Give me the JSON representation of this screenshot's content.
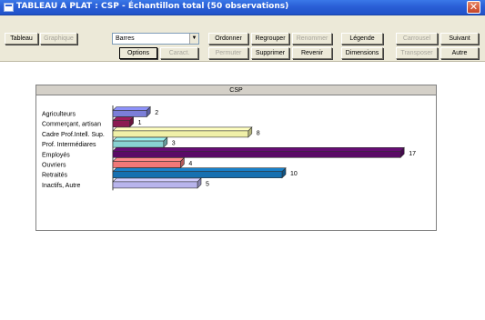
{
  "window": {
    "title": "TABLEAU A PLAT : CSP - Échantillon total (50 observations)"
  },
  "toolbar": {
    "row1": [
      {
        "label": "Tableau",
        "disabled": false
      },
      {
        "label": "Graphique",
        "disabled": true
      },
      {
        "label": "Ordonner",
        "disabled": false
      },
      {
        "label": "Regrouper",
        "disabled": false
      },
      {
        "label": "Renommer",
        "disabled": true
      },
      {
        "label": "Légende",
        "disabled": false
      },
      {
        "label": "Carrousel",
        "disabled": true
      },
      {
        "label": "Suivant",
        "disabled": false
      }
    ],
    "row2": [
      {
        "label": "Options",
        "disabled": false
      },
      {
        "label": "Caract.",
        "disabled": true
      },
      {
        "label": "Permuter",
        "disabled": true
      },
      {
        "label": "Supprimer",
        "disabled": false
      },
      {
        "label": "Revenir",
        "disabled": false
      },
      {
        "label": "Dimensions",
        "disabled": false
      },
      {
        "label": "Transposer",
        "disabled": true
      },
      {
        "label": "Autre",
        "disabled": false
      }
    ],
    "chart_type_select": {
      "value": "Barres",
      "arrow_icon": "chevron-down-icon"
    }
  },
  "chart_data": {
    "type": "bar",
    "orientation": "horizontal",
    "title": "CSP",
    "categories": [
      "Agriculteurs",
      "Commerçant, artisan",
      "Cadre Prof.Intell. Sup.",
      "Prof. Intermédiares",
      "Employés",
      "Ouvriers",
      "Retraités",
      "Inactifs, Autre"
    ],
    "values": [
      2,
      1,
      8,
      3,
      17,
      4,
      10,
      5
    ],
    "colors": [
      "#7b7ed9",
      "#8b1a52",
      "#f0f0a8",
      "#88d2d2",
      "#5a0a66",
      "#f07878",
      "#1670b0",
      "#b8b4ec"
    ],
    "xlim": [
      0,
      17
    ],
    "style": "3d-bars",
    "data_labels": true
  },
  "colors": {
    "titlebar": "#2a5fd6",
    "toolbar_bg": "#ece9d8",
    "chart_header_bg": "#d4d0c8"
  }
}
